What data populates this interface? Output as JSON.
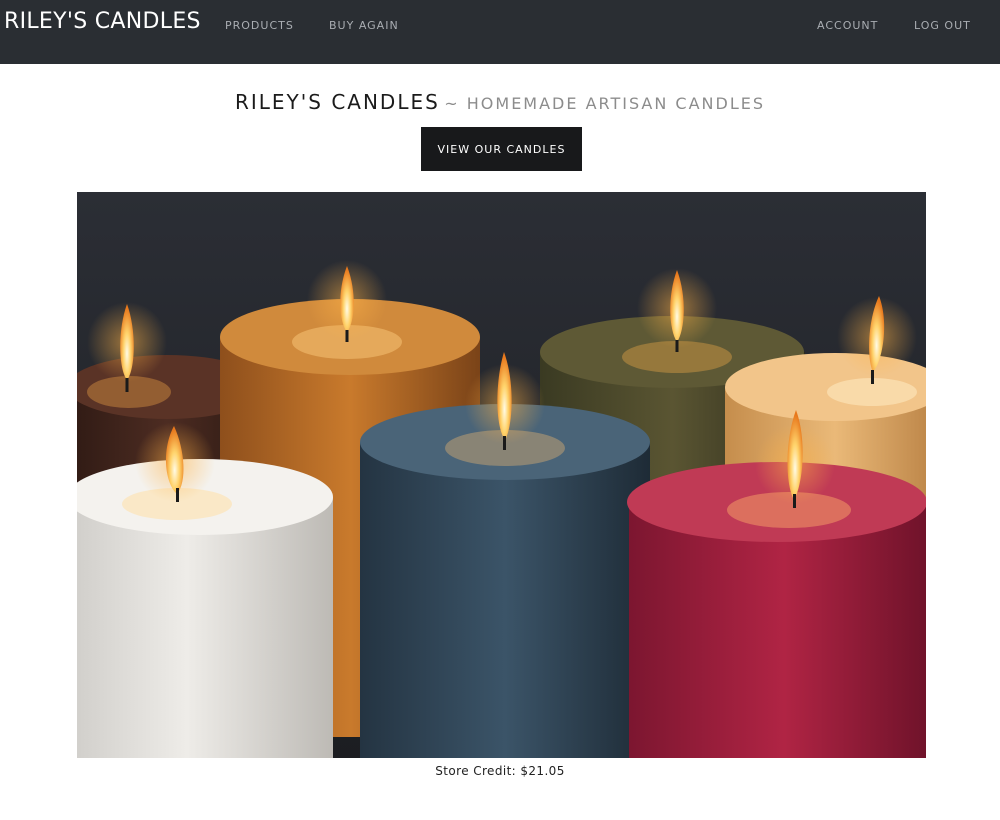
{
  "navbar": {
    "brand": "RILEY'S CANDLES",
    "links": {
      "products": "PRODUCTS",
      "buy_again": "BUY AGAIN",
      "account": "ACCOUNT",
      "log_out": "LOG OUT"
    }
  },
  "header": {
    "title": "RILEY'S CANDLES",
    "subtitle": "~ HOMEMADE ARTISAN CANDLES",
    "cta_label": "VIEW OUR CANDLES"
  },
  "hero": {
    "image": "photo of seven lit pillar candles (brown, amber, olive, tan, white, blue, crimson)"
  },
  "footer": {
    "store_credit": "Store Credit: $21.05"
  },
  "colors": {
    "navbar_bg": "#2a2e33",
    "button_bg": "#18191b",
    "candle_white": "#e8e6e2",
    "candle_blue": "#33495a",
    "candle_crimson": "#a8213f",
    "candle_amber": "#c9782a",
    "candle_olive": "#4e4a2c",
    "candle_tan": "#e6b574",
    "candle_brown": "#4a2a20"
  }
}
